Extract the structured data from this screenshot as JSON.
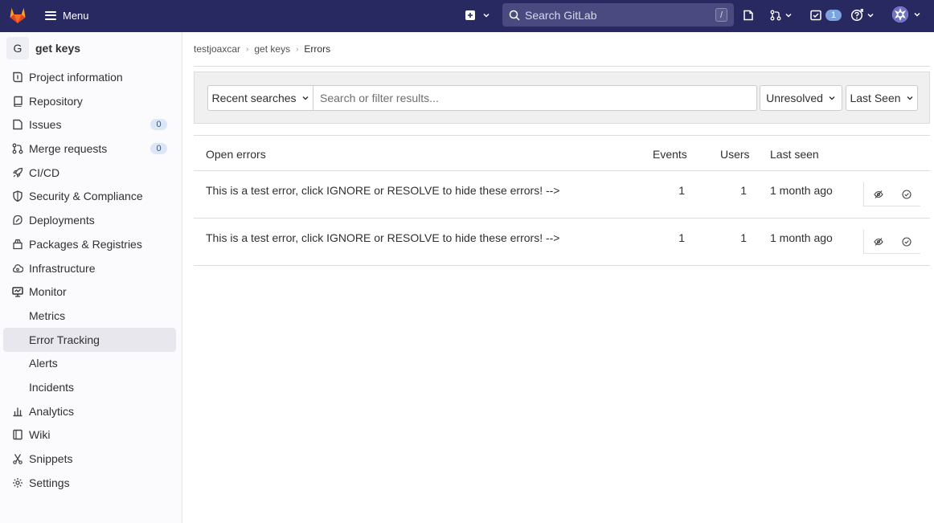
{
  "topbar": {
    "menu_label": "Menu",
    "search_placeholder": "Search GitLab",
    "search_shortcut": "/",
    "todos_count": "1",
    "brand_color": "#292961"
  },
  "sidebar": {
    "project_initial": "G",
    "project_name": "get keys",
    "items": [
      {
        "label": "Project information",
        "icon": "info-icon"
      },
      {
        "label": "Repository",
        "icon": "book-icon"
      },
      {
        "label": "Issues",
        "icon": "issues-icon",
        "count": "0"
      },
      {
        "label": "Merge requests",
        "icon": "merge-request-icon",
        "count": "0"
      },
      {
        "label": "CI/CD",
        "icon": "rocket-icon"
      },
      {
        "label": "Security & Compliance",
        "icon": "shield-icon"
      },
      {
        "label": "Deployments",
        "icon": "deployments-icon"
      },
      {
        "label": "Packages & Registries",
        "icon": "package-icon"
      },
      {
        "label": "Infrastructure",
        "icon": "cloud-icon"
      },
      {
        "label": "Monitor",
        "icon": "monitor-icon"
      },
      {
        "label": "Metrics"
      },
      {
        "label": "Error Tracking"
      },
      {
        "label": "Alerts"
      },
      {
        "label": "Incidents"
      },
      {
        "label": "Analytics",
        "icon": "chart-icon"
      },
      {
        "label": "Wiki",
        "icon": "wiki-icon"
      },
      {
        "label": "Snippets",
        "icon": "snippet-icon"
      },
      {
        "label": "Settings",
        "icon": "gear-icon"
      }
    ]
  },
  "breadcrumb": [
    "testjoaxcar",
    "get keys",
    "Errors"
  ],
  "filters": {
    "recent_label": "Recent searches",
    "search_placeholder": "Search or filter results...",
    "status_label": "Unresolved",
    "sort_label": "Last Seen"
  },
  "table": {
    "headers": {
      "title": "Open errors",
      "events": "Events",
      "users": "Users",
      "last_seen": "Last seen"
    },
    "rows": [
      {
        "title": "This is a test error, click IGNORE or RESOLVE to hide these errors! -->",
        "events": "1",
        "users": "1",
        "last_seen": "1 month ago"
      },
      {
        "title": "This is a test error, click IGNORE or RESOLVE to hide these errors! -->",
        "events": "1",
        "users": "1",
        "last_seen": "1 month ago"
      }
    ]
  }
}
